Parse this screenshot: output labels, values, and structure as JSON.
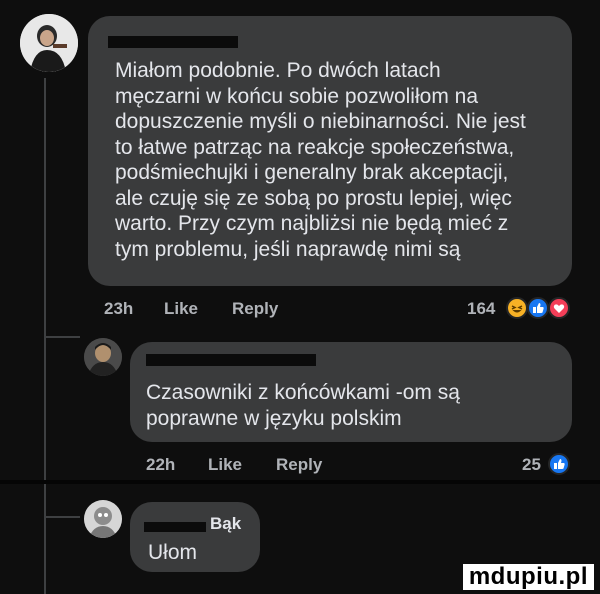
{
  "comments": [
    {
      "author": "",
      "text": "Miałom podobnie. Po dwóch latach\nmęczarni w końcu sobie pozwoliłom na\ndopuszczenie myśli o niebinarności. Nie jest\nto łatwe patrząc na reakcje społeczeństwa,\npodśmiechujki i generalny brak akceptacji,\nale czuję się ze sobą po prostu lepiej, więc\nwarto. Przy czym najbliżsi nie będą mieć z\ntym problemu, jeśli naprawdę nimi są",
      "time": "23h",
      "like": "Like",
      "reply": "Reply",
      "reaction_count": "164",
      "reactions": [
        "haha-icon",
        "like-icon",
        "love-icon"
      ]
    },
    {
      "author": "",
      "text": "Czasowniki z końcówkami -om są\npoprawne w języku polskim",
      "time": "22h",
      "like": "Like",
      "reply": "Reply",
      "reaction_count": "25",
      "reactions": [
        "like-icon"
      ]
    },
    {
      "author": "Bąk",
      "text": "Ułom"
    }
  ],
  "watermark": "mdupiu.pl",
  "colors": {
    "bubble": "#3a3b3c",
    "text": "#e4e6eb",
    "secondary": "#b0b3b8",
    "like_blue": "#1877f2",
    "love_red": "#f33e58",
    "haha_yellow": "#f7b125"
  }
}
